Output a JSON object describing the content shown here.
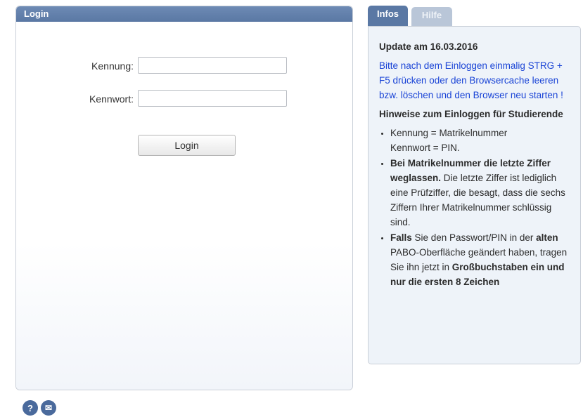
{
  "login": {
    "title": "Login",
    "username_label": "Kennung:",
    "username_value": "",
    "password_label": "Kennwort:",
    "password_value": "",
    "button_label": "Login"
  },
  "tabs": [
    {
      "label": "Infos",
      "active": true
    },
    {
      "label": "Hilfe",
      "active": false
    }
  ],
  "info": {
    "update_title": "Update am 16.03.2016",
    "notice": "Bitte nach dem Einloggen einmalig STRG + F5 drücken oder den Browsercache leeren bzw. löschen und den Browser neu starten !",
    "students_heading": "Hinweise zum Einloggen für Studierende",
    "item1_line1": "Kennung = Matrikelnummer",
    "item1_line2": "Kennwort = PIN.",
    "item2_bold": "Bei Matrikelnummer die letzte Ziffer weglassen.",
    "item2_rest": " Die letzte Ziffer ist lediglich eine Prüfziffer, die besagt, dass die sechs Ziffern Ihrer Matrikelnummer schlüssig sind.",
    "item3_bold1": "Falls",
    "item3_text1": " Sie den Passwort/PIN in der ",
    "item3_bold2": "alten",
    "item3_text2": " PABO-Oberfläche geändert haben, tragen Sie ihn jetzt in ",
    "item3_bold3": "Großbuchstaben ein und nur die ersten 8 Zeichen"
  },
  "footer": {
    "help_glyph": "?",
    "mail_glyph": "✉",
    "icons": [
      "help-icon",
      "mail-icon"
    ]
  },
  "colors": {
    "header_blue": "#5a78a4",
    "notice_blue": "#1a44d6",
    "info_bg": "#eef3f9"
  }
}
